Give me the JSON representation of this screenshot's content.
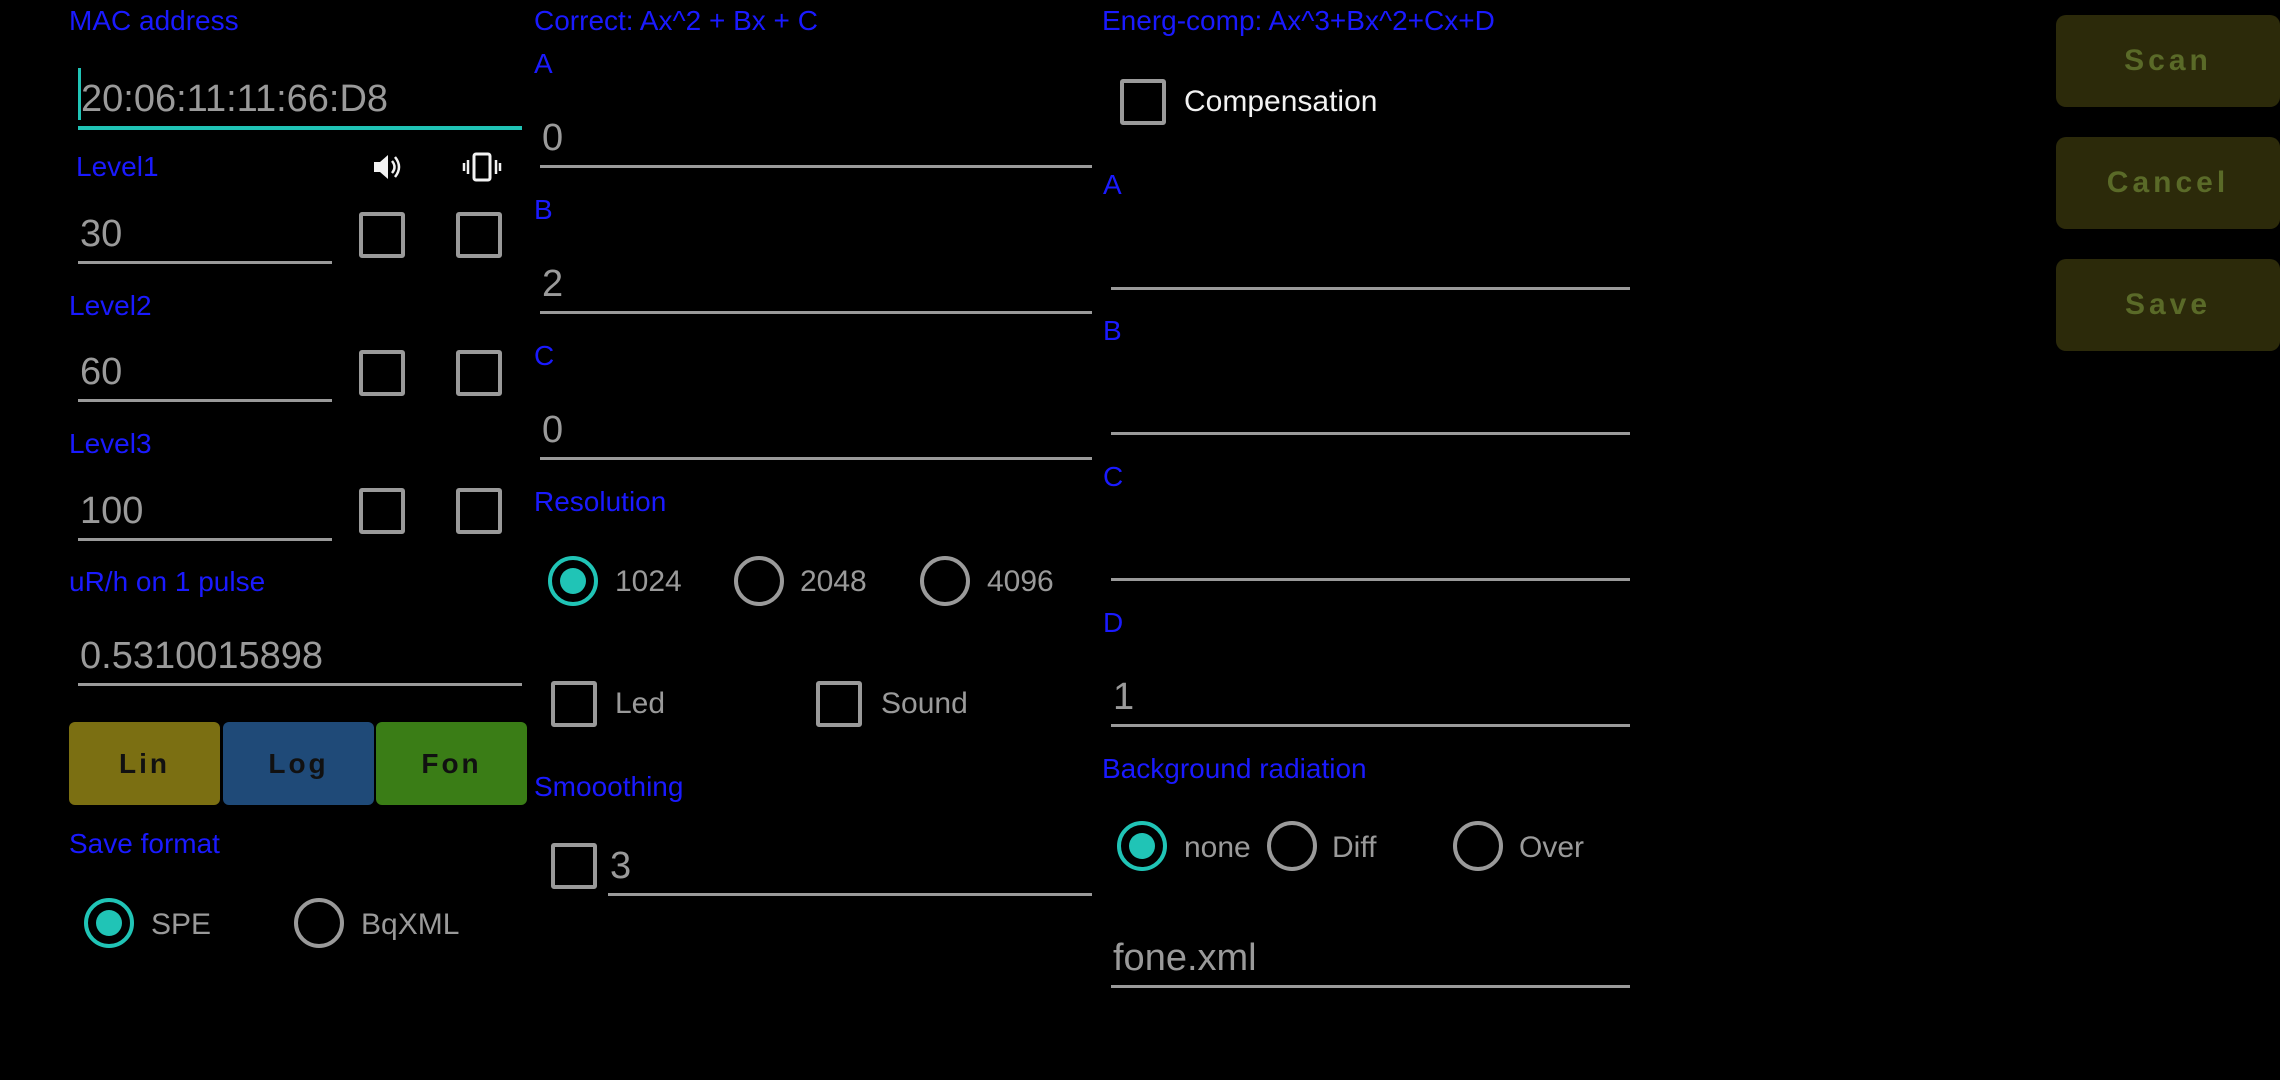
{
  "col1": {
    "mac_label": "MAC address",
    "mac_value": "20:06:11:11:66:D8",
    "level1_label": "Level1",
    "level1_value": "30",
    "level2_label": "Level2",
    "level2_value": "60",
    "level3_label": "Level3",
    "level3_value": "100",
    "sound_icon": "speaker-icon",
    "vibrate_icon": "vibrate-icon",
    "pulse_label": "uR/h on 1 pulse",
    "pulse_value": "0.5310015898",
    "buttons": {
      "lin": "Lin",
      "log": "Log",
      "fon": "Fon"
    },
    "colors": {
      "lin_bg": "#7b6f12",
      "log_bg": "#1f4a78",
      "fon_bg": "#3a7d16"
    },
    "save_format_label": "Save format",
    "save_format_options": [
      "SPE",
      "BqXML"
    ],
    "save_format_selected": "SPE"
  },
  "col2": {
    "correct_label": "Correct: Ax^2 + Bx + C",
    "a_label": "A",
    "a_value": "0",
    "b_label": "B",
    "b_value": "2",
    "c_label": "C",
    "c_value": "0",
    "resolution_label": "Resolution",
    "resolution_options": [
      "1024",
      "2048",
      "4096"
    ],
    "resolution_selected": "1024",
    "led_label": "Led",
    "sound_label": "Sound",
    "smoothing_label": "Smooothing",
    "smoothing_value": "3"
  },
  "col3": {
    "energ_label": "Energ-comp: Ax^3+Bx^2+Cx+D",
    "compensation_label": "Compensation",
    "a_label": "A",
    "a_value": "",
    "b_label": "B",
    "b_value": "",
    "c_label": "C",
    "c_value": "",
    "d_label": "D",
    "d_value": "1",
    "background_label": "Background radiation",
    "background_options": [
      "none",
      "Diff",
      "Over"
    ],
    "background_selected": "none",
    "fone_file": "fone.xml"
  },
  "side": {
    "scan": "Scan",
    "cancel": "Cancel",
    "save": "Save"
  },
  "theme": {
    "label_color": "#1a1aff",
    "accent": "#20c4b6"
  }
}
